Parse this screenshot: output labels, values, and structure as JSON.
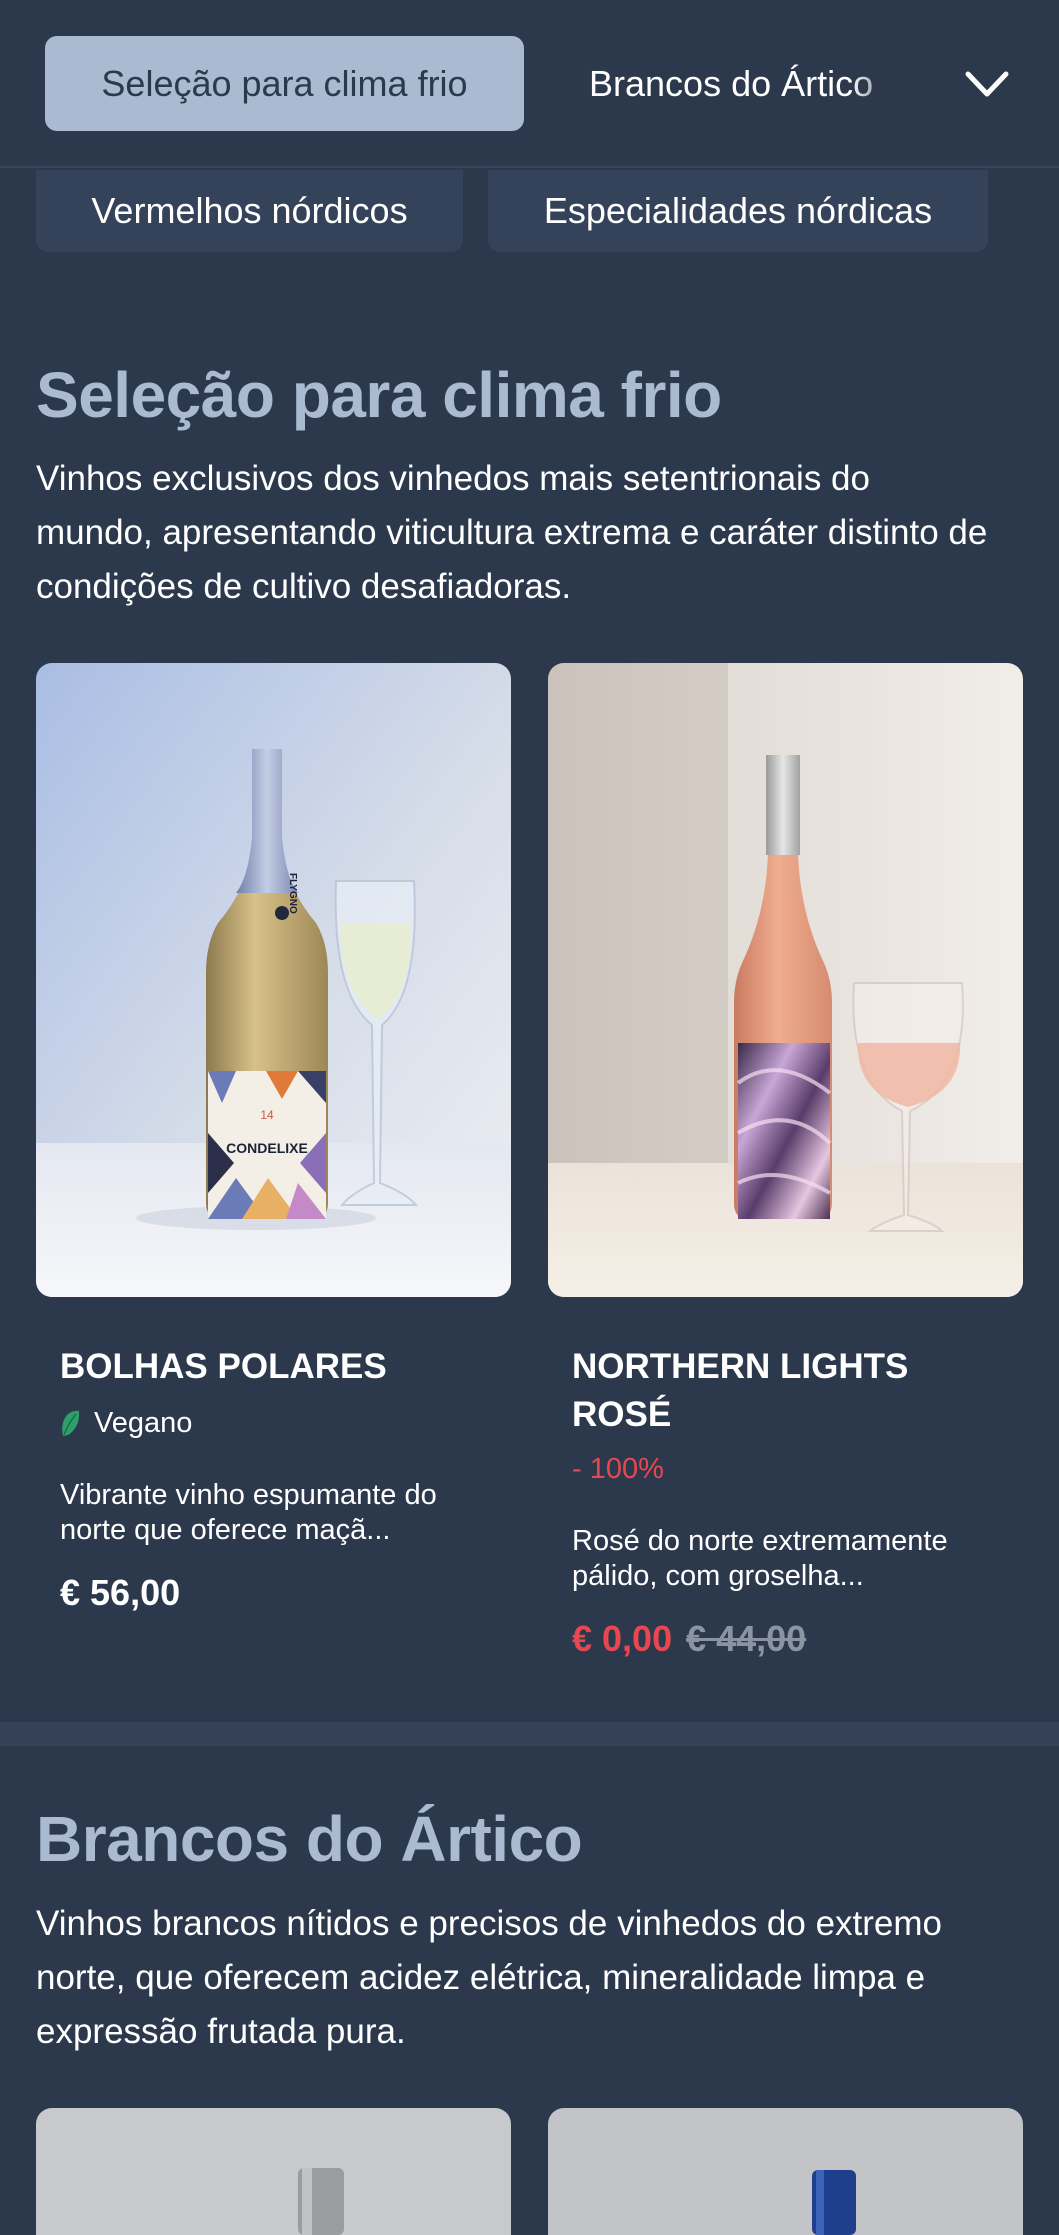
{
  "nav": {
    "active_tab": "Seleção para clima frio",
    "inline_tab": "Brancos do Ártico",
    "row2_tabs": [
      "Vermelhos nórdicos",
      "Especialidades nórdicas"
    ]
  },
  "sections": [
    {
      "title": "Seleção para clima frio",
      "description": "Vinhos exclusivos dos vinhedos mais setentrionais do mundo, apresentando viticultura extrema e caráter distinto de condições de cultivo desafiadoras.",
      "products": [
        {
          "name": "BOLHAS POLARES",
          "tag": "Vegano",
          "description": "Vibrante vinho espumante do norte que oferece maçã...",
          "price": "€ 56,00",
          "bottle_label_brand": "FLYGNO",
          "bottle_label_name": "CONDELIXE",
          "bottle_label_number": "14"
        },
        {
          "name": "NORTHERN LIGHTS ROSÉ",
          "discount": "- 100%",
          "description": "Rosé do norte extremamente pálido, com groselha...",
          "price_sale": "€ 0,00",
          "price_original": "€ 44,00"
        }
      ]
    },
    {
      "title": "Brancos do Ártico",
      "description": "Vinhos brancos nítidos e precisos de vinhedos do extremo norte, que oferecem acidez elétrica, mineralidade limpa e expressão frutada pura."
    }
  ],
  "colors": {
    "background": "#2c394d",
    "accent": "#a9bad1",
    "sale": "#e8474f",
    "vegan_leaf": "#2e9e6a"
  },
  "icons": {
    "dropdown": "chevron-down-icon",
    "vegan": "leaf-icon"
  }
}
